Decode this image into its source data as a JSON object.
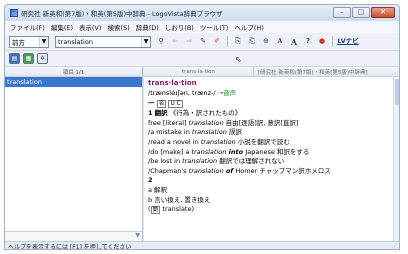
{
  "window": {
    "title": "研究社 新英和(第7版)・和英(第5版)中辞典 - LogoVista辞典ブラウザ",
    "minimize": "–",
    "maximize": "□",
    "close": "✕"
  },
  "menu": [
    "ファイル(F)",
    "編集(E)",
    "表示(V)",
    "検索(S)",
    "辞典(D)",
    "しおり(B)",
    "ツール(T)",
    "ヘルプ(H)"
  ],
  "toolbar": {
    "mode_value": "前方",
    "search_value": "translation",
    "nav_label": "LVナビ"
  },
  "left_pane": {
    "header": "項目 1/1",
    "items": [
      "translation"
    ]
  },
  "right_pane": {
    "header_left": "trans·la·tion",
    "header_right": "[研究社 新英和(第7版)・和英(第5版)中辞典]",
    "entry": {
      "headword": "trans·la·tion",
      "pron": "/trænsléɪʃən, trænz-/",
      "pron_link": "→音声",
      "pos_num": "一",
      "pos_box": "名",
      "pos_box2": "U C",
      "sense1_num": "1",
      "sense1_box": "翻訳",
      "sense1_text": "《行為・訳されたもの》",
      "examples": [
        {
          "a": "free [literal] ",
          "i": "translation",
          "j": "  自由[逐語]訳, 意訳[直訳]"
        },
        {
          "a": "/a mistake in ",
          "i": "translation",
          "j": "  誤訳"
        },
        {
          "a": "/read a novel in ",
          "i": "translation",
          "j": "  小説を翻訳で読む"
        },
        {
          "a": "/do [make] a ",
          "i": "translation",
          "b": " into ",
          "rest": "Japanese",
          "j": "  和訳をする"
        },
        {
          "a": "/be lost in ",
          "i": "translation",
          "j": "  翻訳では理解されない"
        },
        {
          "a": "/Chapman's ",
          "i": "translation",
          "b": " of ",
          "rest": "Homer",
          "j": "  チャップマン訳ホメロス"
        }
      ],
      "sense2_num": "2",
      "sense2_a": "a 解釈",
      "sense2_b": "b 言い換え, 置き換え",
      "verb_note": "(",
      "verb_box": "動",
      "verb_text": " translate)"
    }
  },
  "status": "ヘルプを表示するには [F1] を押してください"
}
